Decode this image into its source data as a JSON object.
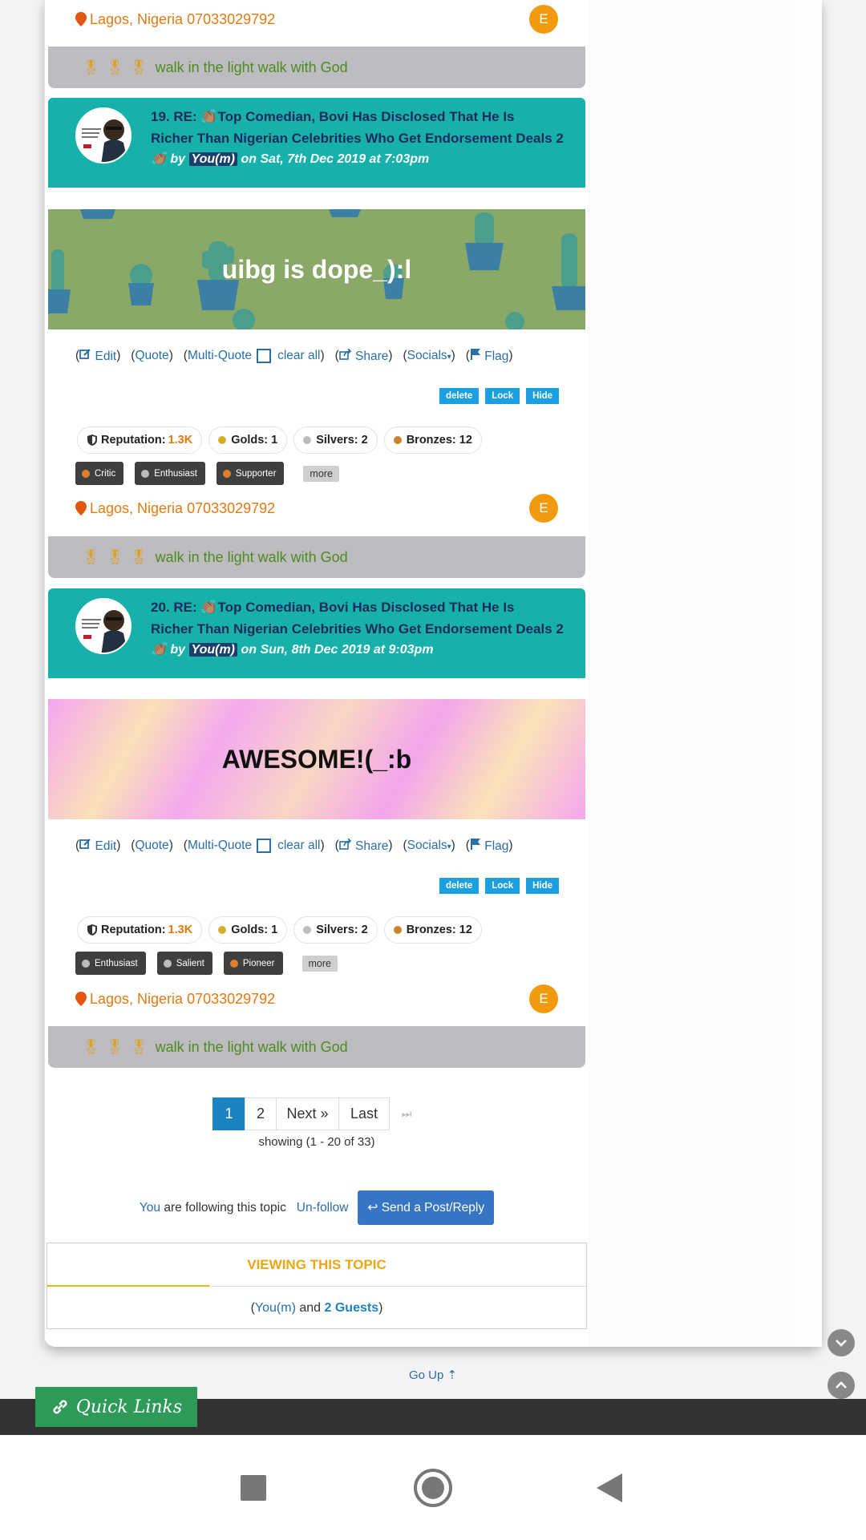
{
  "colors": {
    "header_teal": "#17b1ac",
    "title_navy": "#1f2a5a",
    "location_orange": "#e27a12",
    "signature_green": "#4e8a1e",
    "link_blue": "#2a6fa8",
    "accent_blue": "#1a84c2",
    "quick_links_green": "#2e9a57"
  },
  "location": "Lagos, Nigeria 07033029792",
  "avatar_initial": "E",
  "signature": "walk in the light walk with God",
  "actions": {
    "edit": "Edit",
    "quote": "Quote",
    "multi_quote": "Multi-Quote",
    "clear_all": "clear all",
    "share": "Share",
    "socials": "Socials",
    "flag": "Flag"
  },
  "mod_buttons": {
    "delete": "delete",
    "lock": "Lock",
    "hide": "Hide"
  },
  "stats": {
    "reputation_label": "Reputation:",
    "reputation_value": "1.3K",
    "golds": "Golds: 1",
    "silvers": "Silvers: 2",
    "bronzes": "Bronzes: 12"
  },
  "more_label": "more",
  "posts": [
    {
      "title_line1": "19.   RE: 👏🏽Top Comedian, Bovi Has Disclosed That He Is",
      "title_line2": "Richer Than Nigerian Celebrities Who Get Endorsement Deals 2",
      "by_prefix": "👏🏽 by",
      "author": "You(m)",
      "date": "on Sat, 7th Dec 2019 at 7:03pm",
      "banner_text": "uibg is dope_):l",
      "badges": [
        "Critic",
        "Enthusiast",
        "Supporter"
      ]
    },
    {
      "title_line1": "20.   RE: 👏🏽Top Comedian, Bovi Has Disclosed That He Is",
      "title_line2": "Richer Than Nigerian Celebrities Who Get Endorsement Deals 2",
      "by_prefix": "👏🏽 by",
      "author": "You(m)",
      "date": "on Sun, 8th Dec 2019 at 9:03pm",
      "banner_text": "AWESOME!(_:b",
      "badges": [
        "Enthusiast",
        "Salient",
        "Pioneer"
      ]
    }
  ],
  "pagination": {
    "pages": [
      "1",
      "2"
    ],
    "next": "Next »",
    "last": "Last",
    "showing": "showing (1 - 20 of 33)"
  },
  "follow": {
    "you": "You",
    "text": "are following this topic",
    "unfollow": "Un-follow",
    "reply": "Send a Post/Reply"
  },
  "viewing": {
    "title": "VIEWING THIS TOPIC",
    "you": "You(m)",
    "and": "and",
    "guests": "2 Guests"
  },
  "go_up": "Go Up ⇡",
  "quick_links": "Quick Links"
}
